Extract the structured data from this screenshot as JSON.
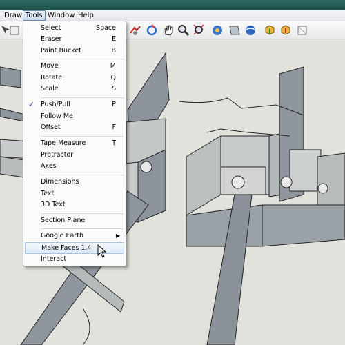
{
  "menubar": {
    "items": [
      {
        "label": "Draw"
      },
      {
        "label": "Tools"
      },
      {
        "label": "Window"
      },
      {
        "label": "Help"
      }
    ]
  },
  "toolbar": {
    "tools": [
      "select-tool",
      "paint-tool",
      "follow-me-tool",
      "orbit-tool",
      "pan-tool",
      "zoom-tool",
      "zoom-extents-tool",
      "previous-view-tool",
      "camera-tool",
      "google-earth-tool",
      "get-models-tool",
      "share-model-tool",
      "components-tool"
    ]
  },
  "tools_menu": {
    "items": [
      {
        "label": "Select",
        "shortcut": "Space"
      },
      {
        "label": "Eraser",
        "shortcut": "E"
      },
      {
        "label": "Paint Bucket",
        "shortcut": "B"
      },
      {
        "label": "Move",
        "shortcut": "M"
      },
      {
        "label": "Rotate",
        "shortcut": "Q"
      },
      {
        "label": "Scale",
        "shortcut": "S"
      },
      {
        "label": "Push/Pull",
        "shortcut": "P",
        "checked": true
      },
      {
        "label": "Follow Me",
        "shortcut": ""
      },
      {
        "label": "Offset",
        "shortcut": "F"
      },
      {
        "label": "Tape Measure",
        "shortcut": "T"
      },
      {
        "label": "Protractor",
        "shortcut": ""
      },
      {
        "label": "Axes",
        "shortcut": ""
      },
      {
        "label": "Dimensions",
        "shortcut": ""
      },
      {
        "label": "Text",
        "shortcut": ""
      },
      {
        "label": "3D Text",
        "shortcut": ""
      },
      {
        "label": "Section Plane",
        "shortcut": ""
      },
      {
        "label": "Google Earth",
        "shortcut": "",
        "submenu": true
      },
      {
        "label": "Make Faces 1.4",
        "shortcut": "",
        "highlighted": true
      },
      {
        "label": "Interact",
        "shortcut": ""
      }
    ]
  },
  "colors": {
    "menu_highlight": "#dce8f7",
    "title_bar": "#2f6b64",
    "model_wall": "#8c939b",
    "model_floor": "#c9cccc"
  }
}
